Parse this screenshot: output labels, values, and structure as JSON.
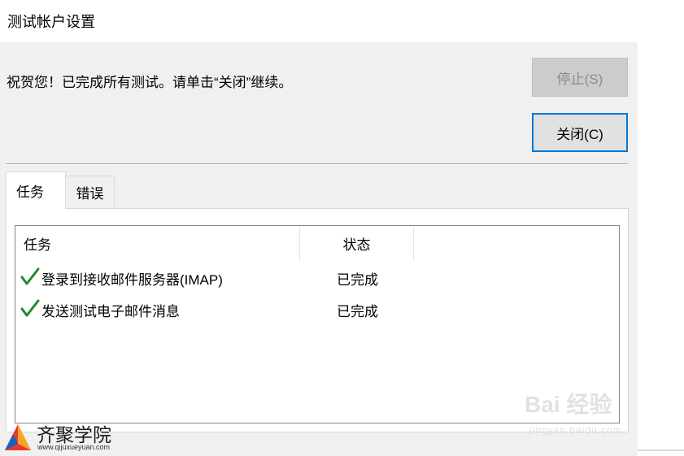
{
  "window": {
    "title": "测试帐户设置"
  },
  "message": "祝贺您！已完成所有测试。请单击“关闭”继续。",
  "buttons": {
    "stop": "停止(S)",
    "close": "关闭(C)"
  },
  "tabs": [
    {
      "label": "任务",
      "active": true
    },
    {
      "label": "错误",
      "active": false
    }
  ],
  "table": {
    "columns": [
      "任务",
      "状态"
    ],
    "rows": [
      {
        "task": "登录到接收邮件服务器(IMAP)",
        "status": "已完成",
        "icon": "checkmark-icon"
      },
      {
        "task": "发送测试电子邮件消息",
        "status": "已完成",
        "icon": "checkmark-icon"
      }
    ]
  },
  "watermarks": {
    "baidu_text": "Bai 经验",
    "baidu_url": "jingyan.baidu.com",
    "school_name": "齐聚学院",
    "school_url": "www.qijuxueyuan.com"
  },
  "colors": {
    "check": "#1e8a2e",
    "focus_border": "#0078d7",
    "dialog_bg": "#f0f0f0"
  }
}
